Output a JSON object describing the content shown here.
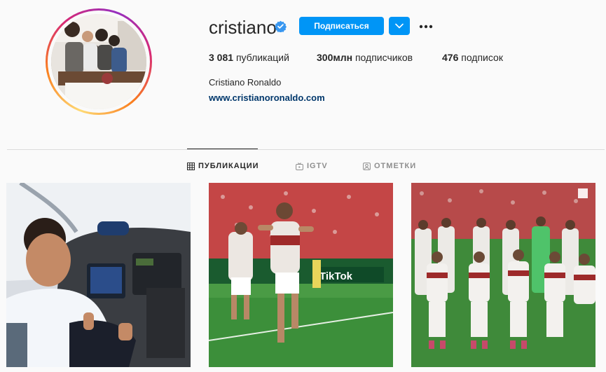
{
  "profile": {
    "username": "cristiano",
    "follow_label": "Подписаться",
    "full_name": "Cristiano Ronaldo",
    "website": "www.cristianoronaldo.com"
  },
  "stats": {
    "posts_count": "3 081",
    "posts_label": "публикаций",
    "followers_count": "300млн",
    "followers_label": "подписчиков",
    "following_count": "476",
    "following_label": "подписок"
  },
  "tabs": [
    {
      "label": "ПУБЛИКАЦИИ",
      "icon": "grid-icon",
      "active": true
    },
    {
      "label": "IGTV",
      "icon": "igtv-icon",
      "active": false
    },
    {
      "label": "ОТМЕТКИ",
      "icon": "tagged-icon",
      "active": false
    }
  ],
  "posts": [
    {
      "alt_subject": "child-in-airplane-cockpit"
    },
    {
      "alt_subject": "football-player-celebrating"
    },
    {
      "alt_subject": "team-photo"
    }
  ],
  "colors": {
    "accent": "#0095f6",
    "link": "#00376b",
    "text": "#262626",
    "muted": "#8e8e8e"
  }
}
